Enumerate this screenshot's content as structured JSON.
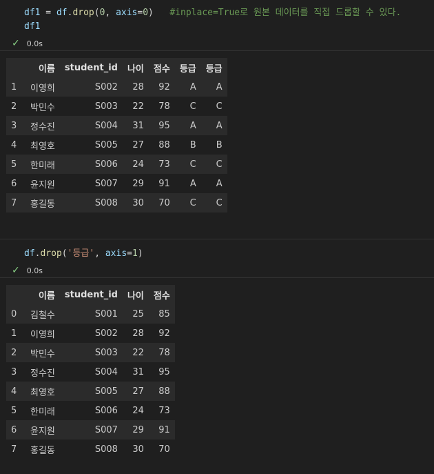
{
  "cell1": {
    "code_line1": {
      "var": "df1",
      "eq": " = ",
      "obj": "df",
      "dot": ".",
      "method": "drop",
      "open": "(",
      "arg0": "0",
      "comma": ", ",
      "kw": "axis",
      "kweq": "=",
      "kwval": "0",
      "close": ")",
      "comment": "#inplace=True로 원본 데이터를 직접 드롭할 수 있다."
    },
    "code_line2": "df1",
    "status_time": "0.0s",
    "table": {
      "columns": [
        "",
        "이름",
        "student_id",
        "나이",
        "점수",
        "등급",
        "등급"
      ],
      "rows": [
        [
          "1",
          "이영희",
          "S002",
          "28",
          "92",
          "A",
          "A"
        ],
        [
          "2",
          "박민수",
          "S003",
          "22",
          "78",
          "C",
          "C"
        ],
        [
          "3",
          "정수진",
          "S004",
          "31",
          "95",
          "A",
          "A"
        ],
        [
          "4",
          "최영호",
          "S005",
          "27",
          "88",
          "B",
          "B"
        ],
        [
          "5",
          "한미래",
          "S006",
          "24",
          "73",
          "C",
          "C"
        ],
        [
          "6",
          "윤지원",
          "S007",
          "29",
          "91",
          "A",
          "A"
        ],
        [
          "7",
          "홍길동",
          "S008",
          "30",
          "70",
          "C",
          "C"
        ]
      ]
    }
  },
  "cell2": {
    "code_line1": {
      "obj": "df",
      "dot": ".",
      "method": "drop",
      "open": "(",
      "arg0": "'등급'",
      "comma": ", ",
      "kw": "axis",
      "kweq": "=",
      "kwval": "1",
      "close": ")"
    },
    "status_time": "0.0s",
    "table": {
      "columns": [
        "",
        "이름",
        "student_id",
        "나이",
        "점수"
      ],
      "rows": [
        [
          "0",
          "김철수",
          "S001",
          "25",
          "85"
        ],
        [
          "1",
          "이영희",
          "S002",
          "28",
          "92"
        ],
        [
          "2",
          "박민수",
          "S003",
          "22",
          "78"
        ],
        [
          "3",
          "정수진",
          "S004",
          "31",
          "95"
        ],
        [
          "4",
          "최영호",
          "S005",
          "27",
          "88"
        ],
        [
          "5",
          "한미래",
          "S006",
          "24",
          "73"
        ],
        [
          "6",
          "윤지원",
          "S007",
          "29",
          "91"
        ],
        [
          "7",
          "홍길동",
          "S008",
          "30",
          "70"
        ]
      ]
    }
  },
  "icons": {
    "status": "check-icon"
  },
  "colors": {
    "background": "#1f1f1f",
    "check": "#89d185",
    "comment": "#6a9955",
    "variable": "#9cdcfe",
    "function": "#dcdcaa",
    "number": "#b5cea8",
    "string": "#ce9178"
  }
}
